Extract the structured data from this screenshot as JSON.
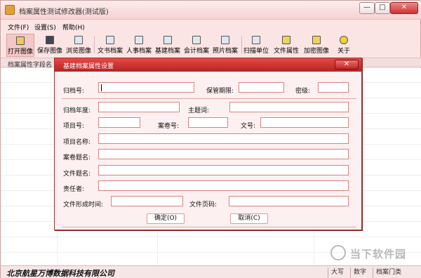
{
  "window": {
    "title": "档案属性测试修改器(测试版)",
    "controls": {
      "minimize": "—",
      "maximize": "□",
      "close": "✕"
    }
  },
  "menu": [
    {
      "label": "文件(F)"
    },
    {
      "label": "设置(S)"
    },
    {
      "label": "帮助(H)"
    }
  ],
  "toolbar": [
    {
      "label": "打开图像",
      "icon": "open-folder-icon"
    },
    {
      "label": "保存图像",
      "icon": "save-icon"
    },
    {
      "label": "浏览图像",
      "icon": "browse-icon"
    },
    {
      "label": "文书档案",
      "icon": "archive-icon"
    },
    {
      "label": "人事档案",
      "icon": "archive-icon"
    },
    {
      "label": "基建档案",
      "icon": "archive-icon"
    },
    {
      "label": "会计档案",
      "icon": "archive-icon"
    },
    {
      "label": "照片档案",
      "icon": "archive-icon"
    },
    {
      "label": "扫描单位",
      "icon": "scan-icon"
    },
    {
      "label": "文件属性",
      "icon": "properties-icon"
    },
    {
      "label": "加密图像",
      "icon": "encrypt-icon"
    },
    {
      "label": "关于",
      "icon": "about-icon"
    }
  ],
  "table": {
    "column_header": "档案属性字段名"
  },
  "dialog": {
    "title": "基建档案属性设置",
    "close": "✕",
    "fields": {
      "archive_no": {
        "label": "归档号:",
        "value": ""
      },
      "retention": {
        "label": "保管期限:",
        "value": ""
      },
      "secrecy": {
        "label": "密级:",
        "value": ""
      },
      "archive_year": {
        "label": "归档年度:",
        "value": ""
      },
      "subject": {
        "label": "主题词:",
        "value": ""
      },
      "project_no": {
        "label": "项目号:",
        "value": ""
      },
      "volume_no": {
        "label": "案卷号:",
        "value": ""
      },
      "doc_no": {
        "label": "文号:",
        "value": ""
      },
      "project_name": {
        "label": "项目名称:",
        "value": ""
      },
      "volume_title": {
        "label": "案卷题名:",
        "value": ""
      },
      "file_title": {
        "label": "文件题名:",
        "value": ""
      },
      "responsible": {
        "label": "责任者:",
        "value": ""
      },
      "formed_time": {
        "label": "文件形成时间:",
        "value": ""
      },
      "page_no": {
        "label": "文件页码:",
        "value": ""
      }
    },
    "ok_label": "确定(O)",
    "cancel_label": "取消(C)"
  },
  "status": {
    "company": "北京航星万博数据科技有限公司",
    "caps": "大写",
    "num": "数字",
    "category": "档案门类"
  },
  "watermark": {
    "text": "当下软件园"
  }
}
